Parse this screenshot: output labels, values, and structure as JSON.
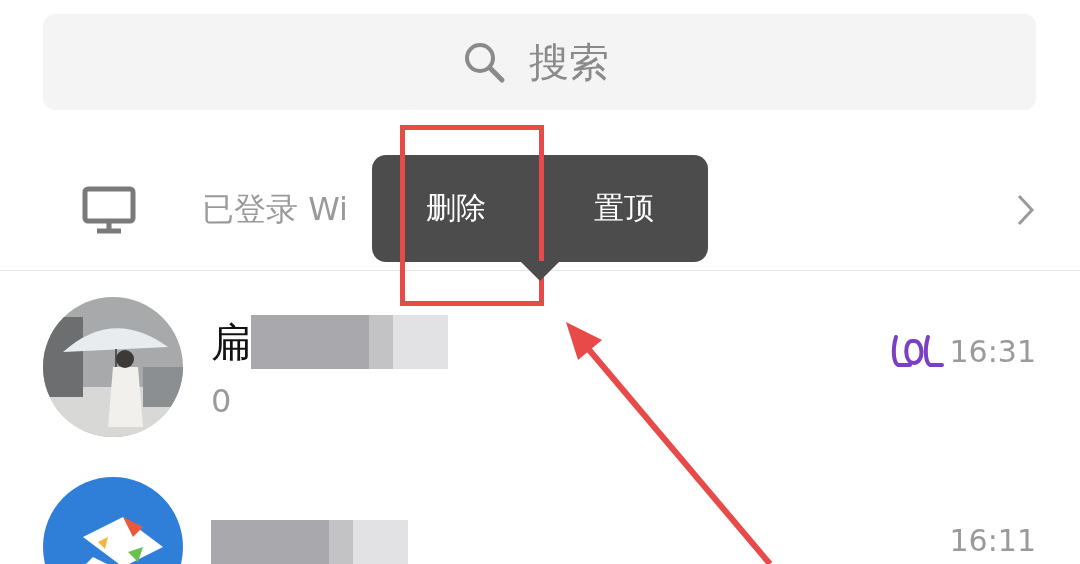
{
  "search": {
    "placeholder": "搜索"
  },
  "login_bar": {
    "text": "已登录 Wi"
  },
  "context_menu": {
    "items": [
      {
        "label": "删除",
        "marked": true
      },
      {
        "label": "置顶",
        "marked": false
      }
    ]
  },
  "chats": [
    {
      "name": "扁",
      "redacted": true,
      "message": "0",
      "badge": true,
      "time": "16:31"
    },
    {
      "redacted": true,
      "badge": false,
      "time": "16:11"
    }
  ]
}
